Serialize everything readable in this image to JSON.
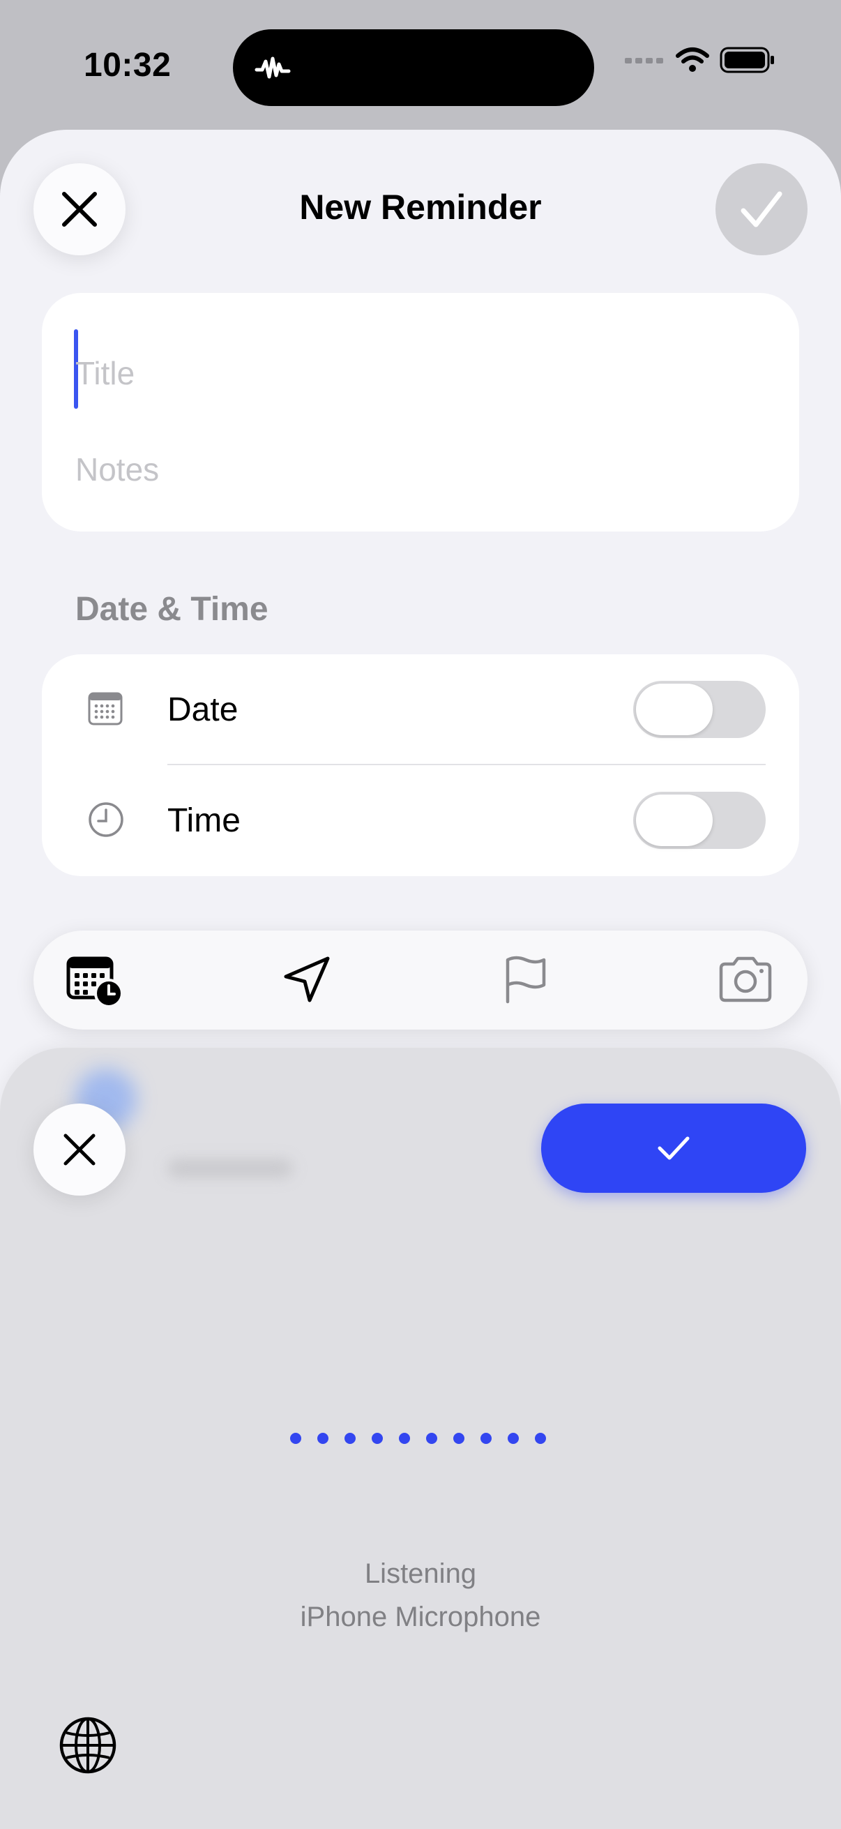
{
  "status_bar": {
    "time": "10:32"
  },
  "sheet": {
    "title": "New Reminder",
    "title_placeholder": "Title",
    "notes_placeholder": "Notes",
    "section_header": "Date & Time",
    "rows": [
      {
        "label": "Date",
        "icon": "calendar-icon",
        "toggle_on": false
      },
      {
        "label": "Time",
        "icon": "clock-icon",
        "toggle_on": false
      }
    ],
    "toolbar": [
      "calendar-clock-icon",
      "location-arrow-icon",
      "flag-icon",
      "camera-icon"
    ]
  },
  "dictation": {
    "status": "Listening",
    "source": "iPhone Microphone",
    "accent": "#2f45f5"
  }
}
